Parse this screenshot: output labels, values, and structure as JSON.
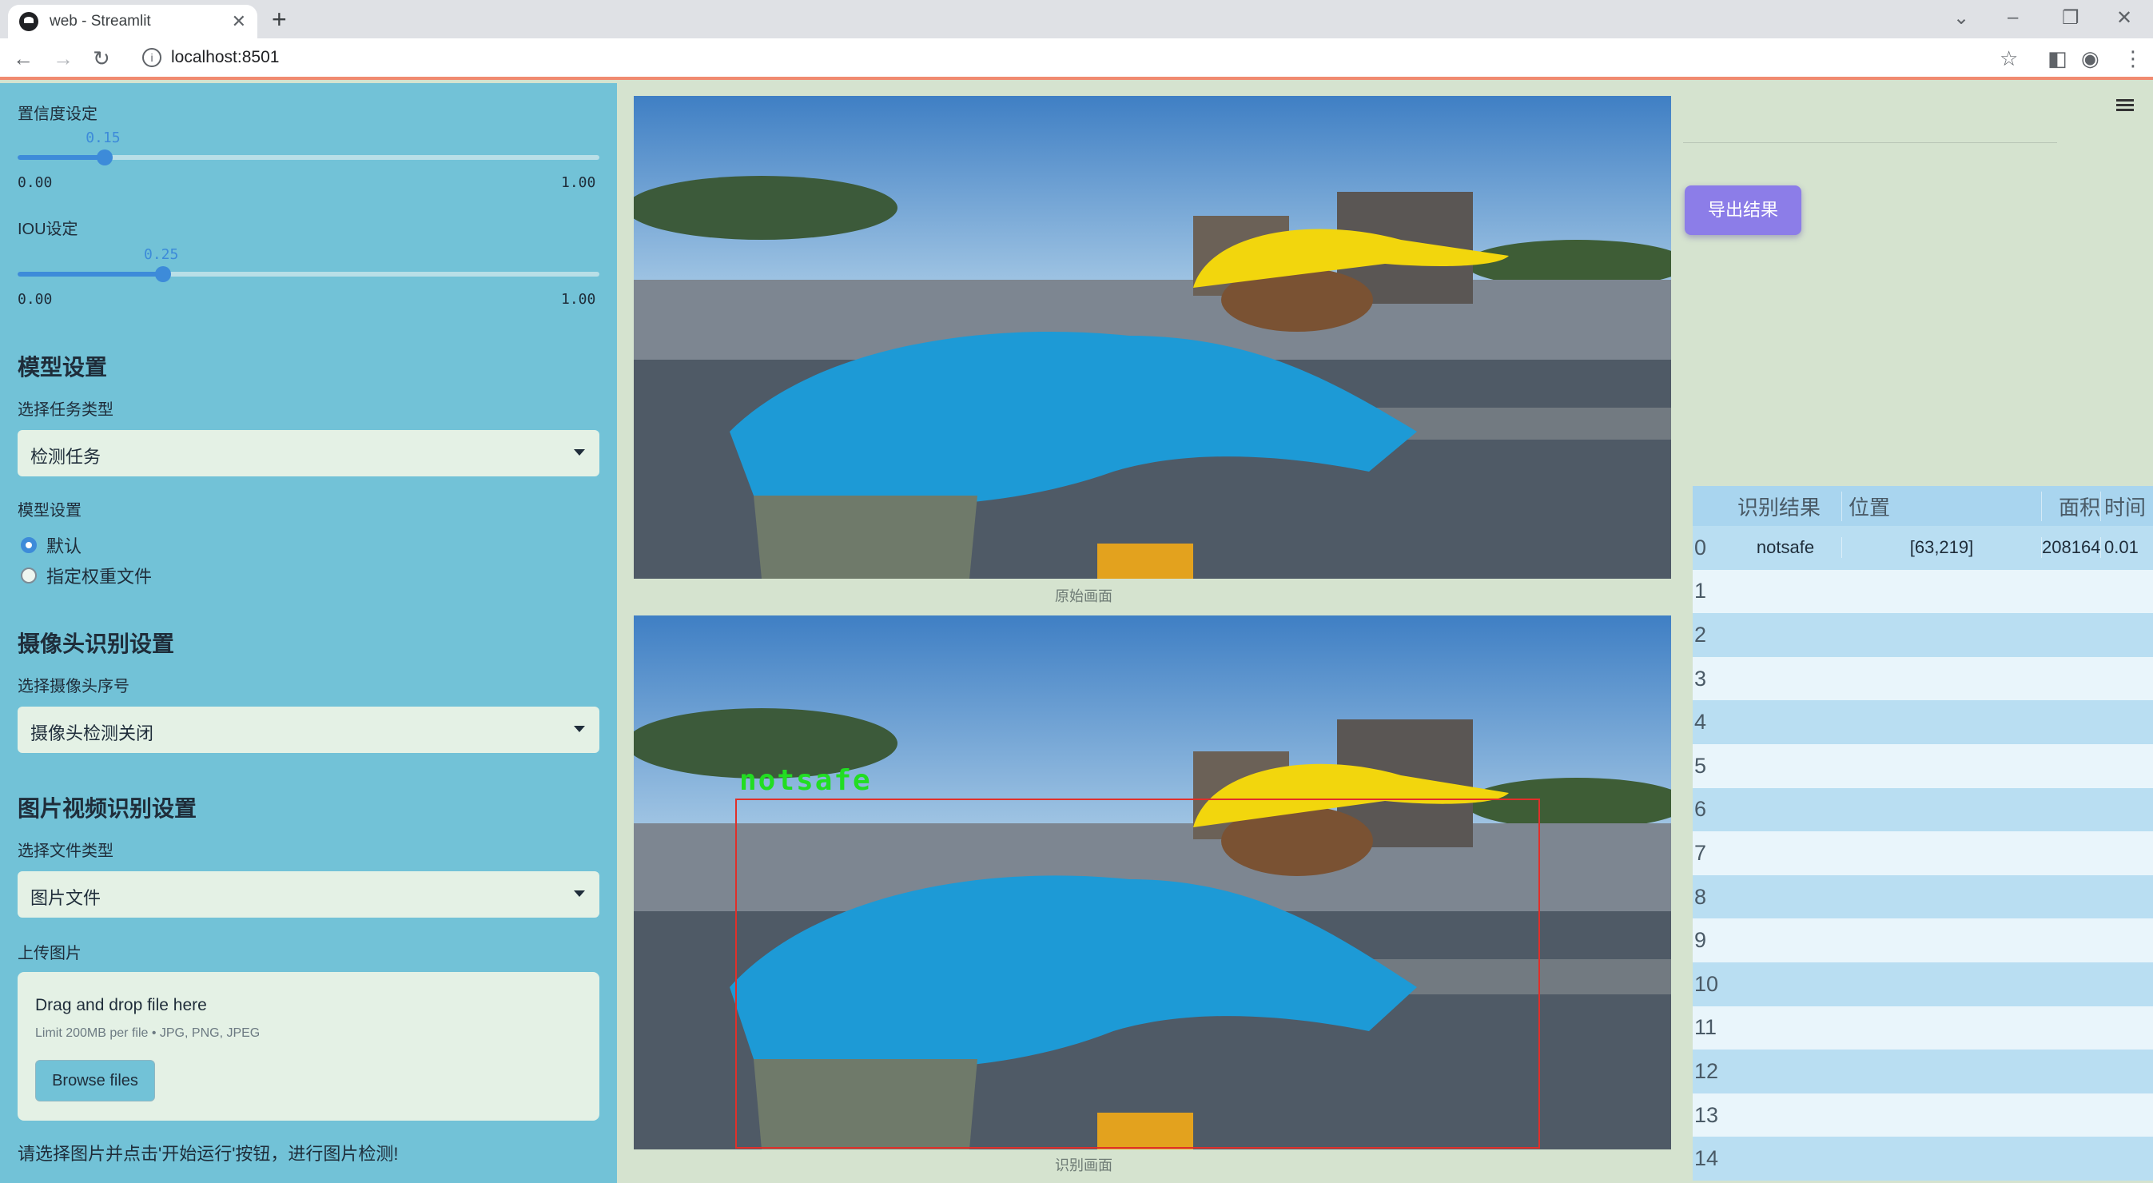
{
  "browser": {
    "tab_title": "web - Streamlit",
    "url": "localhost:8501"
  },
  "sidebar": {
    "confidence_label": "置信度设定",
    "confidence_value": "0.15",
    "confidence_fraction": 0.15,
    "confidence_min": "0.00",
    "confidence_max": "1.00",
    "iou_label": "IOU设定",
    "iou_value": "0.25",
    "iou_fraction": 0.25,
    "iou_min": "0.00",
    "iou_max": "1.00",
    "model_section": "模型设置",
    "task_type_label": "选择任务类型",
    "task_type_value": "检测任务",
    "model_setting_label": "模型设置",
    "radio_default": "默认",
    "radio_custom": "指定权重文件",
    "camera_section": "摄像头识别设置",
    "camera_select_label": "选择摄像头序号",
    "camera_select_value": "摄像头检测关闭",
    "media_section": "图片视频识别设置",
    "file_type_label": "选择文件类型",
    "file_type_value": "图片文件",
    "upload_label": "上传图片",
    "drop_text": "Drag and drop file here",
    "limit_text": "Limit 200MB per file • JPG, PNG, JPEG",
    "browse_label": "Browse files",
    "hint": "请选择图片并点击'开始运行'按钮，进行图片检测!"
  },
  "main": {
    "original_caption": "原始画面",
    "result_caption": "识别画面",
    "detection_label": "notsafe"
  },
  "right": {
    "export_label": "导出结果",
    "table": {
      "headers": [
        "识别结果",
        "位置",
        "面积",
        "时间"
      ],
      "rows": [
        {
          "index": "0",
          "result": "notsafe",
          "position": "[63,219]",
          "area": "208164",
          "time": "0.01"
        },
        {
          "index": "1"
        },
        {
          "index": "2"
        },
        {
          "index": "3"
        },
        {
          "index": "4"
        },
        {
          "index": "5"
        },
        {
          "index": "6"
        },
        {
          "index": "7"
        },
        {
          "index": "8"
        },
        {
          "index": "9"
        },
        {
          "index": "10"
        },
        {
          "index": "11"
        },
        {
          "index": "12"
        },
        {
          "index": "13"
        },
        {
          "index": "14"
        }
      ]
    }
  },
  "colors": {
    "sidebar_bg": "#72c2d7",
    "main_bg": "#d5e3cf",
    "accent": "#3d8bd9",
    "export_button": "#8c7de8",
    "detection_box": "#e0302a",
    "detection_text": "#22dd22"
  }
}
